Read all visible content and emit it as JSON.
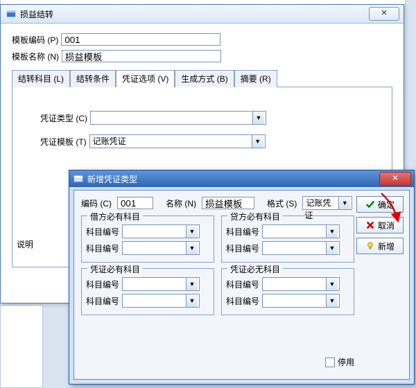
{
  "w1": {
    "title": "损益结转",
    "fields": {
      "template_code_label": "模板编码 (P)",
      "template_code_value": "001",
      "template_name_label": "模板名称 (N)",
      "template_name_value": "损益模板"
    },
    "tabs": {
      "t1": "结转科目 (L)",
      "t2": "结转条件",
      "t3": "凭证选项 (V)",
      "t4": "生成方式 (B)",
      "t5": "摘要 (R)"
    },
    "panel": {
      "voucher_type_label": "凭证类型 (C)",
      "voucher_type_value": "",
      "voucher_template_label": "凭证模板 (T)",
      "voucher_template_value": "记账凭证",
      "note_label": "说明"
    }
  },
  "w2": {
    "title": "新增凭证类型",
    "topline": {
      "code_label": "编码 (C)",
      "code_value": "001",
      "name_label": "名称 (N)",
      "name_value": "损益模板",
      "format_label": "格式 (S)",
      "format_value": "记账凭证"
    },
    "groups": {
      "debit": {
        "legend": "借方必有科目",
        "row1": "科目编号",
        "row2": "科目编号"
      },
      "credit": {
        "legend": "贷方必有科目",
        "row1": "科目编号",
        "row2": "科目编号"
      },
      "must": {
        "legend": "凭证必有科目",
        "row1": "科目编号",
        "row2": "科目编号"
      },
      "mustnot": {
        "legend": "凭证必无科目",
        "row1": "科目编号",
        "row2": "科目编号"
      }
    },
    "disable_label": "停用",
    "buttons": {
      "ok": "确定",
      "cancel": "取消",
      "new": "新增"
    }
  }
}
